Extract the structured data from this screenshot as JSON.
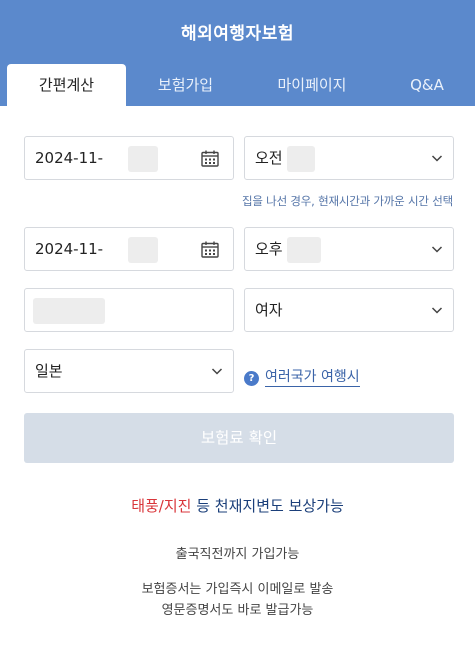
{
  "header": {
    "title": "해외여행자보험"
  },
  "tabs": [
    {
      "label": "간편계산",
      "active": true
    },
    {
      "label": "보험가입",
      "active": false
    },
    {
      "label": "마이페이지",
      "active": false
    },
    {
      "label": "Q&A",
      "active": false
    }
  ],
  "form": {
    "depart_date": "2024-11-",
    "depart_ampm": "오전",
    "depart_hint": "집을 나선 경우, 현재시간과 가까운 시간 선택",
    "return_date": "2024-11-",
    "return_ampm": "오후",
    "gender": "여자",
    "country": "일본",
    "multi_country_link": "여러국가 여행시",
    "help_symbol": "?"
  },
  "confirm_button": "보험료 확인",
  "notices": {
    "disaster_red": "태풍/지진",
    "disaster_rest": " 등 천재지변도 보상가능",
    "line1": "출국직전까지 가입가능",
    "line2": "보험증서는 가입즉시 이메일로 발송",
    "line3": "영문증명서도 바로 발급가능"
  },
  "colors": {
    "header_bg": "#5b89cc",
    "button_disabled": "#d5dde7",
    "accent_red": "#d9363b",
    "link_blue": "#3a63a8"
  }
}
